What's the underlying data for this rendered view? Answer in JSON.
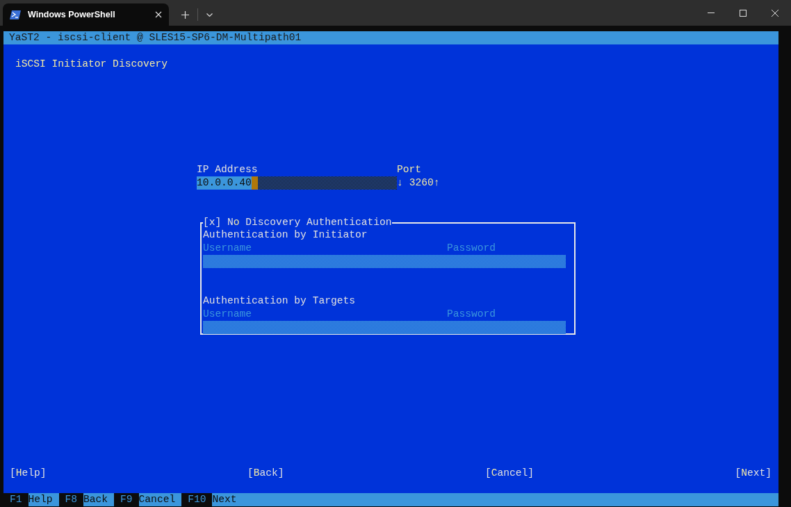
{
  "tab": {
    "title": "Windows PowerShell",
    "selected": true
  },
  "terminal": {
    "title_bar": "YaST2 - iscsi-client @ SLES15-SP6-DM-Multipath01",
    "heading": "iSCSI Initiator Discovery",
    "ip_address": {
      "label": "IP Address",
      "value": "10.0.0.40"
    },
    "port": {
      "label": "Port",
      "down": "↓",
      "value": "3260",
      "up": "↑"
    },
    "auth_group": {
      "mark": "[x]",
      "label": "N**o** Discovery Authentication",
      "checked": true,
      "sections": [
        {
          "title": "Authentication by Initiator",
          "username_label": "Username",
          "password_label": "Password"
        },
        {
          "title": "Authentication by Targets",
          "username_label": "Username",
          "password_label": "Password"
        }
      ]
    },
    "buttons": [
      "[**H**elp]",
      "[**B**ack]",
      "[**C**ancel]",
      "[**N**ext]"
    ],
    "function_keys": [
      {
        "key": "F1",
        "label": "Help"
      },
      {
        "key": "F8",
        "label": "Back"
      },
      {
        "key": "F9",
        "label": "Cancel"
      },
      {
        "key": "F10",
        "label": "Next"
      }
    ]
  }
}
